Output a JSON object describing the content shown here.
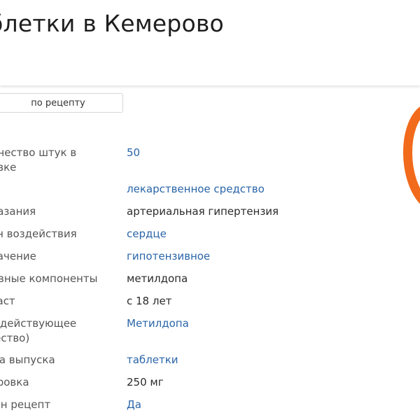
{
  "page": {
    "title": "блетки в Кемерово"
  },
  "filters": {
    "prescription_button": "по рецепту"
  },
  "accent_color": "#f26a1b",
  "link_color": "#2a65a8",
  "specs": [
    {
      "label": "личество штук в\nковке",
      "value": "50",
      "link": true
    },
    {
      "label": "п",
      "value": "лекарственное средство",
      "link": true
    },
    {
      "label": "оказания",
      "value": "артериальная гипертензия",
      "link": false
    },
    {
      "label": "ган воздействия",
      "value": "сердце",
      "link": true
    },
    {
      "label": "значение",
      "value": "гипотензивное",
      "link": true
    },
    {
      "label": "новные компоненты",
      "value": "метилдопа",
      "link": false
    },
    {
      "label": "зраст",
      "value": "с 18 лет",
      "link": false
    },
    {
      "label": "Н (действующее\nщество)",
      "value": "Метилдопа",
      "link": true
    },
    {
      "label": "рма выпуска",
      "value": "таблетки",
      "link": true
    },
    {
      "label": "зировка",
      "value": "250 мг",
      "link": false
    },
    {
      "label": "жен рецепт",
      "value": "Да",
      "link": true
    }
  ]
}
